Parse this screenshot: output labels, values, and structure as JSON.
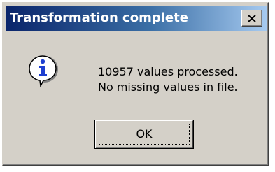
{
  "window": {
    "title": "Transformation complete",
    "close_icon": "close-icon"
  },
  "message": {
    "icon": "info-icon",
    "line1": "10957 values processed.",
    "line2": "No missing values in file."
  },
  "buttons": {
    "ok_label": "OK"
  },
  "colors": {
    "titlebar_start": "#0a246a",
    "titlebar_end": "#a6caf0",
    "dialog_face": "#d4d0c8",
    "info_blue": "#1e3fd0"
  }
}
